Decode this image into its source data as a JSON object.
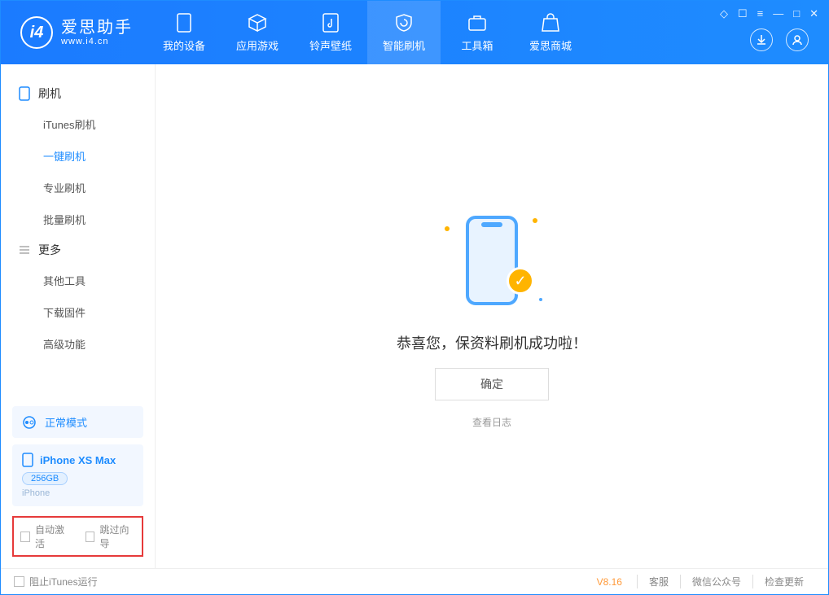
{
  "app": {
    "title": "爱思助手",
    "subtitle": "www.i4.cn"
  },
  "tabs": {
    "device": "我的设备",
    "apps": "应用游戏",
    "ringtone": "铃声壁纸",
    "flash": "智能刷机",
    "toolbox": "工具箱",
    "store": "爱思商城"
  },
  "sidebar": {
    "group_flash": "刷机",
    "items_flash": {
      "itunes": "iTunes刷机",
      "oneclick": "一键刷机",
      "pro": "专业刷机",
      "batch": "批量刷机"
    },
    "group_more": "更多",
    "items_more": {
      "other": "其他工具",
      "firmware": "下载固件",
      "advanced": "高级功能"
    },
    "mode": "正常模式",
    "device_name": "iPhone XS Max",
    "device_capacity": "256GB",
    "device_type": "iPhone",
    "auto_activate": "自动激活",
    "skip_wizard": "跳过向导"
  },
  "main": {
    "success": "恭喜您，保资料刷机成功啦！",
    "ok": "确定",
    "view_log": "查看日志"
  },
  "footer": {
    "block_itunes": "阻止iTunes运行",
    "version": "V8.16",
    "support": "客服",
    "wechat": "微信公众号",
    "update": "检查更新"
  }
}
